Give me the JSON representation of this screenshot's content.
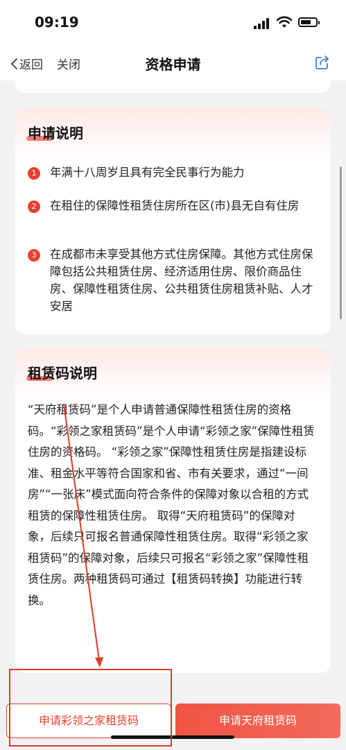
{
  "status_bar": {
    "time": "09:19"
  },
  "nav": {
    "back_label": "返回",
    "close_label": "关闭",
    "title": "资格申请"
  },
  "application_card": {
    "title": "申请说明",
    "items": [
      {
        "number": "1",
        "text": "年满十八周岁且具有完全民事行为能力"
      },
      {
        "number": "2",
        "text": "在租住的保障性租赁住房所在区(市)县无自有住房"
      },
      {
        "number": "3",
        "text": "在成都市未享受其他方式住房保障。其他方式住房保障包括公共租赁住房、经济适用住房、限价商品住房、保障性租赁住房、公共租赁住房租赁补贴、人才安居"
      }
    ]
  },
  "code_card": {
    "title": "租赁码说明",
    "description": "“天府租赁码”是个人申请普通保障性租赁住房的资格码。“彩领之家租赁码”是个人申请“彩领之家”保障性租赁住房的资格码。 “彩领之家”保障性租赁住房是指建设标准、租金水平等符合国家和省、市有关要求，通过“一间房”“一张床”模式面向符合条件的保障对象以合租的方式租赁的保障性租赁住房。 取得“天府租赁码”的保障对象，后续只可报名普通保障性租赁住房。取得“彩领之家租赁码”的保障对象，后续只可报名“彩领之家”保障性租赁住房。两种租赁码可通过【租赁码转换】功能进行转换。"
  },
  "bottom_bar": {
    "left_button": "申请彩领之家租赁码",
    "right_button": "申请天府租赁码"
  },
  "colors": {
    "accent": "#e8412f",
    "button_gradient_start": "#f05444",
    "annotation": "#e03a2a"
  }
}
